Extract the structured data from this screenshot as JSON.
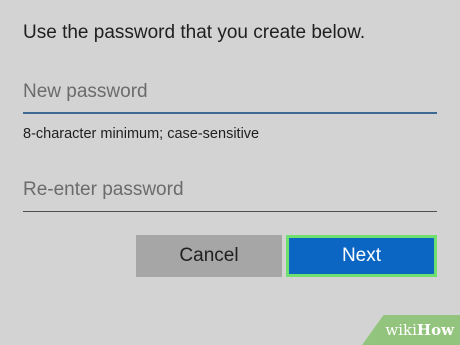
{
  "instruction": "Use the password that you create below.",
  "new_password": {
    "placeholder": "New password",
    "value": ""
  },
  "hint": "8-character minimum; case-sensitive",
  "reenter_password": {
    "placeholder": "Re-enter password",
    "value": ""
  },
  "buttons": {
    "cancel_label": "Cancel",
    "next_label": "Next"
  },
  "watermark": {
    "wiki": "wiki",
    "how": "How"
  },
  "colors": {
    "background": "#d3d3d3",
    "next_button": "#0a66c2",
    "next_button_highlight": "#6fe06f",
    "cancel_button": "#a6a6a6",
    "active_underline": "#3d6a95"
  }
}
